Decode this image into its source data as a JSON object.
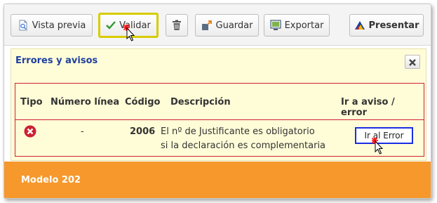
{
  "toolbar": {
    "preview_label": "Vista previa",
    "validate_label": "Validar",
    "save_label": "Guardar",
    "export_label": "Exportar",
    "submit_label": "Presentar"
  },
  "errors_panel": {
    "title": "Errores y avisos",
    "columns": {
      "type": "Tipo",
      "line_number": "Número línea",
      "code": "Código",
      "description": "Descripción",
      "goto": "Ir a aviso / error"
    },
    "rows": [
      {
        "type_icon": "error-icon",
        "line_number": "-",
        "code": "2006",
        "description_line1": "El nº de Justificante es obligatorio",
        "description_line2": "si la declaración es complementaria",
        "goto_label": "Ir al Error"
      }
    ]
  },
  "footer": {
    "model_label": "Modelo 202"
  },
  "colors": {
    "highlight_yellow": "#d8cc00",
    "highlight_blue": "#1a2fe0",
    "error_red": "#cc2233",
    "footer_orange": "#f6982b",
    "panel_bg": "#fffdd8",
    "title_blue": "#1f3f9f"
  }
}
